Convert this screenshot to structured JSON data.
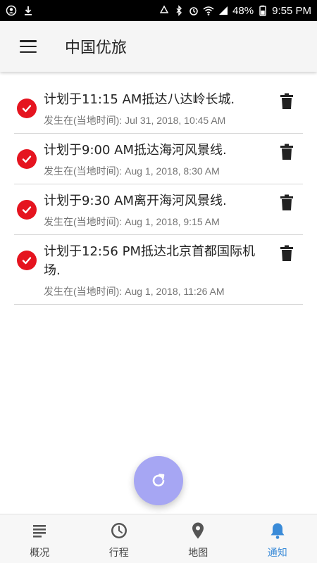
{
  "status_bar": {
    "battery": "48%",
    "time": "9:55 PM"
  },
  "app_bar": {
    "title": "中国优旅"
  },
  "notifications": [
    {
      "text": "计划于11:15 AM抵达八达岭长城.",
      "time": "发生在(当地时间): Jul 31, 2018, 10:45 AM"
    },
    {
      "text": "计划于9:00 AM抵达海河风景线.",
      "time": "发生在(当地时间): Aug 1, 2018, 8:30 AM"
    },
    {
      "text": "计划于9:30 AM离开海河风景线.",
      "time": "发生在(当地时间): Aug 1, 2018, 9:15 AM"
    },
    {
      "text": "计划于12:56 PM抵达北京首都国际机场.",
      "time": "发生在(当地时间): Aug 1, 2018, 11:26 AM"
    }
  ],
  "fab": {
    "icon": "refresh-icon"
  },
  "bottom_nav": [
    {
      "label": "概况",
      "icon": "overview-icon"
    },
    {
      "label": "行程",
      "icon": "itinerary-clock-icon"
    },
    {
      "label": "地图",
      "icon": "map-pin-icon"
    },
    {
      "label": "通知",
      "icon": "bell-icon"
    }
  ],
  "colors": {
    "check_red": "#e5141f",
    "fab": "#a6a6f3",
    "active_tab": "#3a8bd8"
  }
}
